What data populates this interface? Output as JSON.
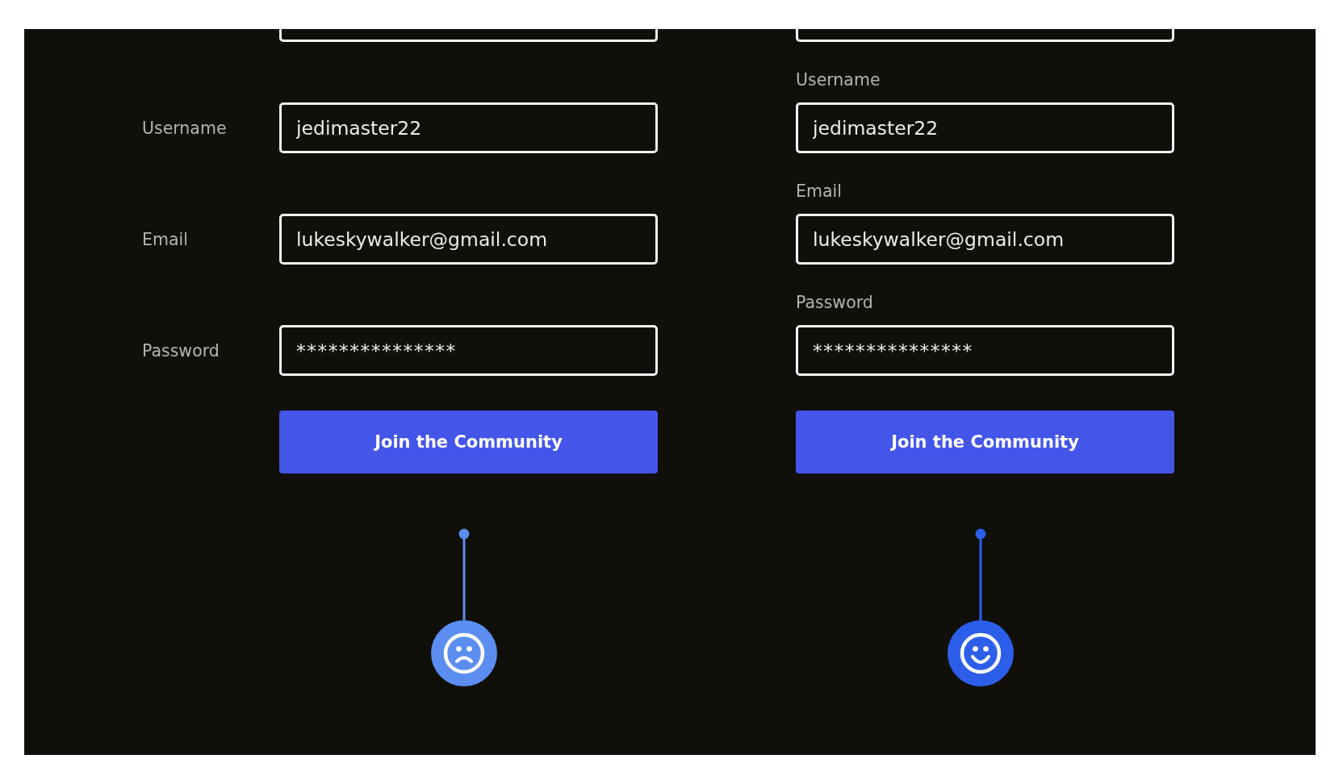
{
  "forms": [
    {
      "kind": "side",
      "fields": [
        {
          "kind": "clipped"
        },
        {
          "kind": "input",
          "label": "Username",
          "value": "jedimaster22"
        },
        {
          "kind": "input",
          "label": "Email",
          "value": "lukeskywalker@gmail.com"
        },
        {
          "kind": "password",
          "label": "Password",
          "value": "***************"
        }
      ],
      "button": "Join the Community",
      "reaction": {
        "kind": "sad",
        "color": "#5b8ef0"
      }
    },
    {
      "kind": "top",
      "fields": [
        {
          "kind": "clipped"
        },
        {
          "kind": "input",
          "label": "Username",
          "value": "jedimaster22"
        },
        {
          "kind": "input",
          "label": "Email",
          "value": "lukeskywalker@gmail.com"
        },
        {
          "kind": "password",
          "label": "Password",
          "value": "***************"
        }
      ],
      "button": "Join the Community",
      "reaction": {
        "kind": "happy",
        "color": "#2c5ee9"
      }
    }
  ]
}
